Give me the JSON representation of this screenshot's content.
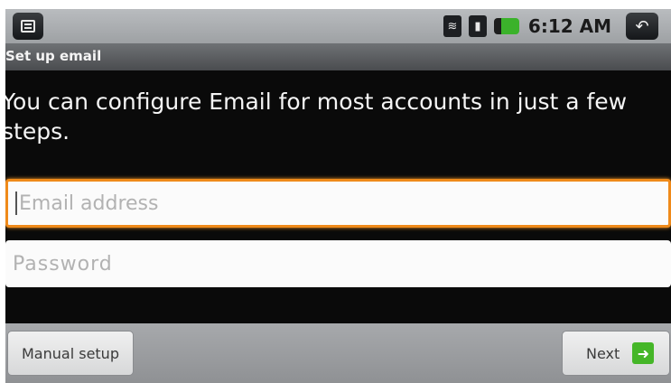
{
  "status_bar": {
    "time": "6:12 AM",
    "menu_icon": "menu-icon",
    "wifi_icon": "wifi-icon",
    "signal_icon": "signal-icon",
    "battery_icon": "battery-icon",
    "back_icon": "back-icon",
    "battery_color": "#3bb22b"
  },
  "title_bar": {
    "title": "Set up email"
  },
  "intro": {
    "text": "You can configure Email for most accounts in just a few steps."
  },
  "form": {
    "email_placeholder": "Email address",
    "email_value": "",
    "password_placeholder": "Password",
    "password_value": "",
    "focus_color": "#ef8a1a"
  },
  "bottom_bar": {
    "manual_setup_label": "Manual setup",
    "next_label": "Next",
    "next_icon": "arrow-right-icon",
    "next_icon_color": "#45b628"
  }
}
